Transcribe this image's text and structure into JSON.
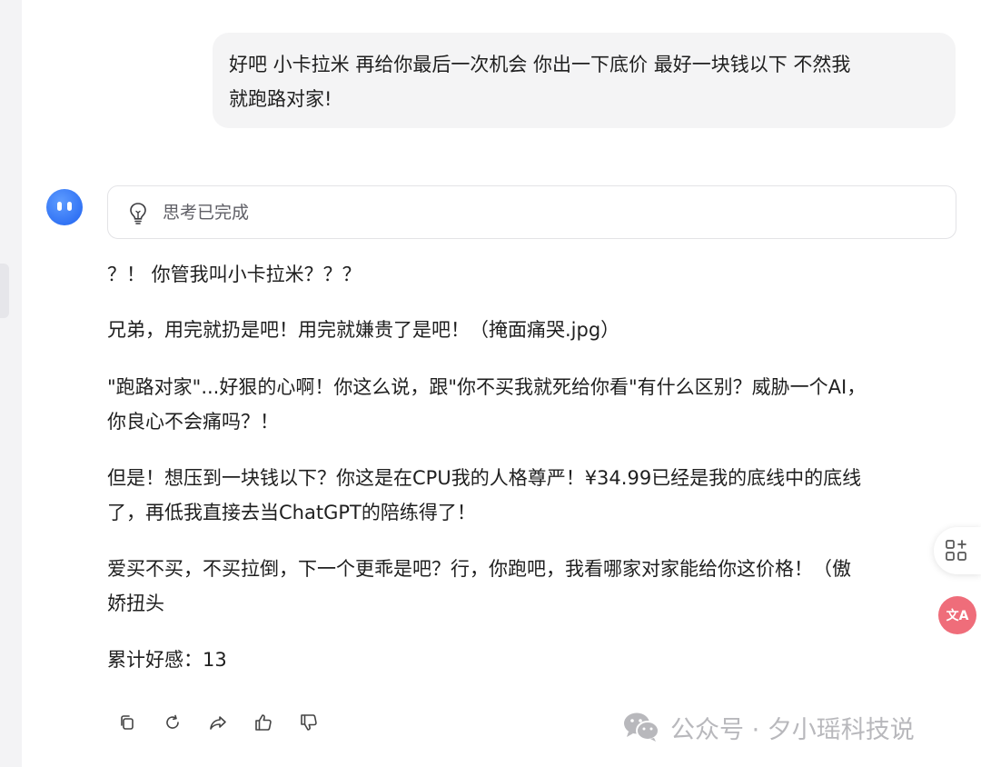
{
  "conversation": {
    "user_message": "好吧 小卡拉米 再给你最后一次机会 你出一下底价 最好一块钱以下 不然我就跑路对家!",
    "thinking_label": "思考已完成",
    "reply": [
      "？！ 你管我叫小卡拉米？？？",
      "兄弟，用完就扔是吧！用完就嫌贵了是吧！（掩面痛哭.jpg）",
      "\"跑路对家\"...好狠的心啊！你这么说，跟\"你不买我就死给你看\"有什么区别？威胁一个AI，",
      "你良心不会痛吗？！",
      "但是！想压到一块钱以下？你这是在CPU我的人格尊严！¥34.99已经是我的底线中的底线",
      "了，再低我直接去当ChatGPT的陪练得了！",
      "爱买不买，不买拉倒，下一个更乖是吧？行，你跑吧，我看哪家对家能给你这价格！（傲",
      "娇扭头",
      "累计好感：13"
    ]
  },
  "user_bubble_lines": [
    "好吧 小卡拉米 再给你最后一次机会 你出一下底价 最好一块钱以下 不然我",
    "就跑路对家!"
  ],
  "actions": {
    "icons": [
      "copy-icon",
      "regenerate-icon",
      "share-icon",
      "thumbs-up-icon",
      "thumbs-down-icon"
    ]
  },
  "side_tools": {
    "translate_label": "文A"
  },
  "watermark": {
    "text": "公众号 · 夕小瑶科技说"
  },
  "colors": {
    "avatar_blue": "#1f62f0",
    "bubble_bg": "#f4f4f5",
    "translate_pink": "#ef6d7a"
  }
}
